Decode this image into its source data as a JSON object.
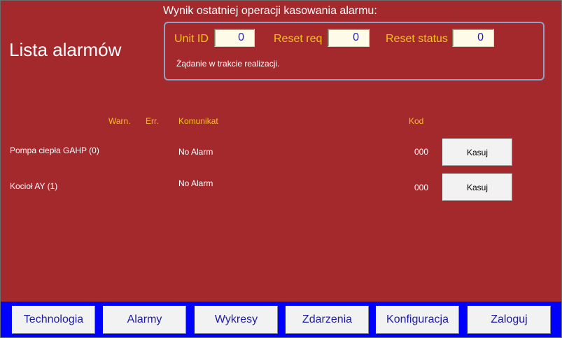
{
  "page": {
    "title": "Lista alarmów"
  },
  "reset_result": {
    "caption": "Wynik ostatniej operacji kasowania alarmu:",
    "unit_id_label": "Unit ID",
    "unit_id_value": "0",
    "reset_req_label": "Reset req",
    "reset_req_value": "0",
    "reset_status_label": "Reset status",
    "reset_status_value": "0",
    "status_message": "Żądanie w trakcie realizacji."
  },
  "alarm_table": {
    "headers": {
      "warn": "Warn.",
      "err": "Err.",
      "message": "Komunikat",
      "code": "Kod"
    },
    "rows": [
      {
        "device": "Pompa ciepła GAHP (0)",
        "message": "No Alarm",
        "code": "000",
        "action": "Kasuj"
      },
      {
        "device": "Kocioł AY (1)",
        "message": "No Alarm",
        "code": "000",
        "action": "Kasuj"
      }
    ]
  },
  "nav": {
    "items": [
      {
        "label": "Technologia"
      },
      {
        "label": "Alarmy"
      },
      {
        "label": "Wykresy"
      },
      {
        "label": "Zdarzenia"
      },
      {
        "label": "Konfiguracja"
      },
      {
        "label": "Zaloguj"
      }
    ]
  },
  "colors": {
    "background": "#a4292d",
    "label_accent": "#f7c21a",
    "value_text": "#1a1ae6",
    "nav_bar": "#0000ff"
  }
}
